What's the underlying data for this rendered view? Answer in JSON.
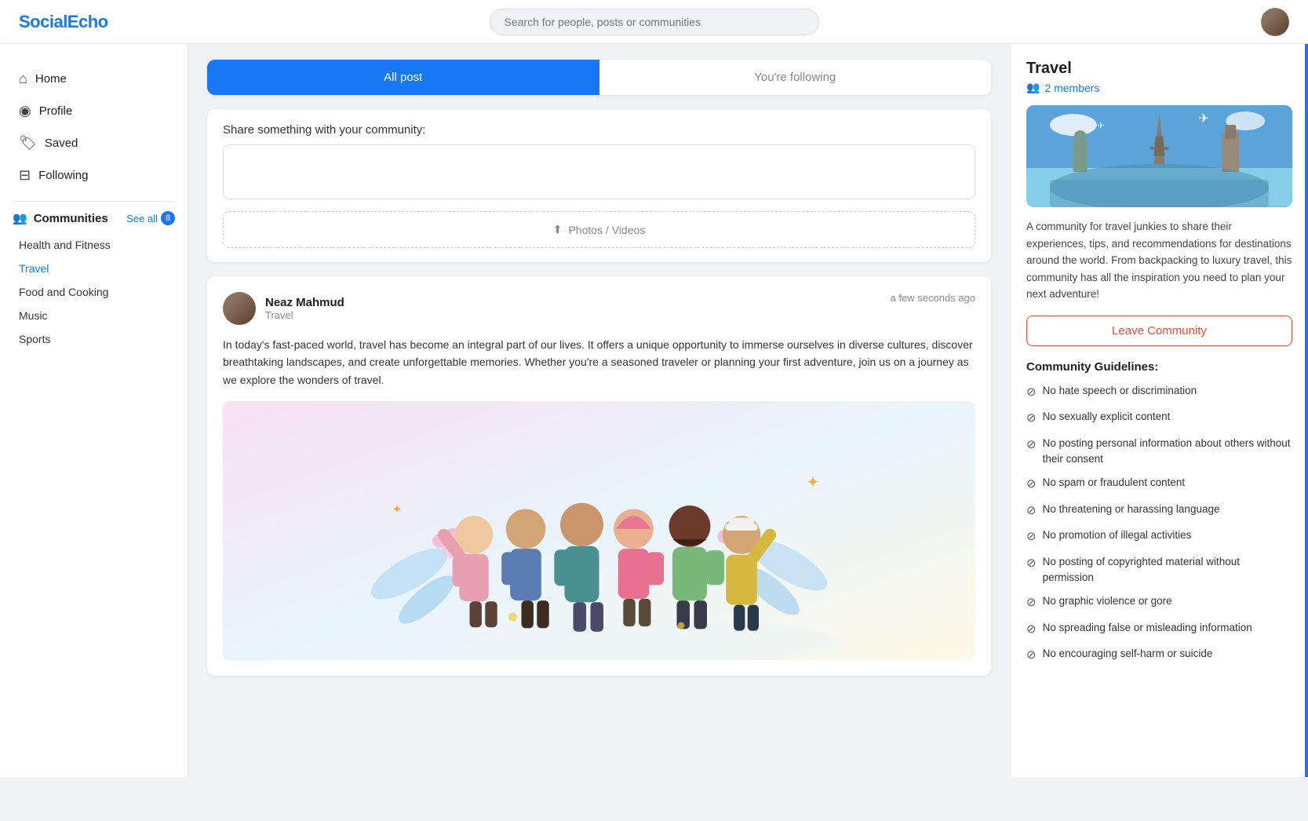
{
  "header": {
    "logo": "SocialEcho",
    "search_placeholder": "Search for people, posts or communities"
  },
  "sidebar": {
    "nav_items": [
      {
        "id": "home",
        "label": "Home",
        "icon": "⌂"
      },
      {
        "id": "profile",
        "label": "Profile",
        "icon": "○"
      },
      {
        "id": "saved",
        "label": "Saved",
        "icon": "◈"
      },
      {
        "id": "following",
        "label": "Following",
        "icon": "⊟"
      }
    ],
    "communities_label": "Communities",
    "see_all_label": "See all",
    "badge_count": "8",
    "community_list": [
      {
        "id": "health",
        "label": "Health and Fitness",
        "active": false
      },
      {
        "id": "travel",
        "label": "Travel",
        "active": true
      },
      {
        "id": "food",
        "label": "Food and Cooking",
        "active": false
      },
      {
        "id": "music",
        "label": "Music",
        "active": false
      },
      {
        "id": "sports",
        "label": "Sports",
        "active": false
      }
    ]
  },
  "tabs": {
    "all_post_label": "All post",
    "following_label": "You're following"
  },
  "composer": {
    "label": "Share something with your community:",
    "placeholder": "",
    "media_label": "Photos / Videos"
  },
  "post": {
    "author_name": "Neaz Mahmud",
    "community": "Travel",
    "time": "a few seconds ago",
    "body": "In today's fast-paced world, travel has become an integral part of our lives. It offers a unique opportunity to immerse ourselves in diverse cultures, discover breathtaking landscapes, and create unforgettable memories. Whether you're a seasoned traveler or planning your first adventure, join us on a journey as we explore the wonders of travel."
  },
  "right_panel": {
    "community_name": "Travel",
    "members_count": "2 members",
    "description": "A community for travel junkies to share their experiences, tips, and recommendations for destinations around the world. From backpacking to luxury travel, this community has all the inspiration you need to plan your next adventure!",
    "leave_button_label": "Leave Community",
    "guidelines_title": "Community Guidelines:",
    "guidelines": [
      "No hate speech or discrimination",
      "No sexually explicit content",
      "No posting personal information about others without their consent",
      "No spam or fraudulent content",
      "No threatening or harassing language",
      "No promotion of illegal activities",
      "No posting of copyrighted material without permission",
      "No graphic violence or gore",
      "No spreading false or misleading information",
      "No encouraging self-harm or suicide"
    ]
  }
}
